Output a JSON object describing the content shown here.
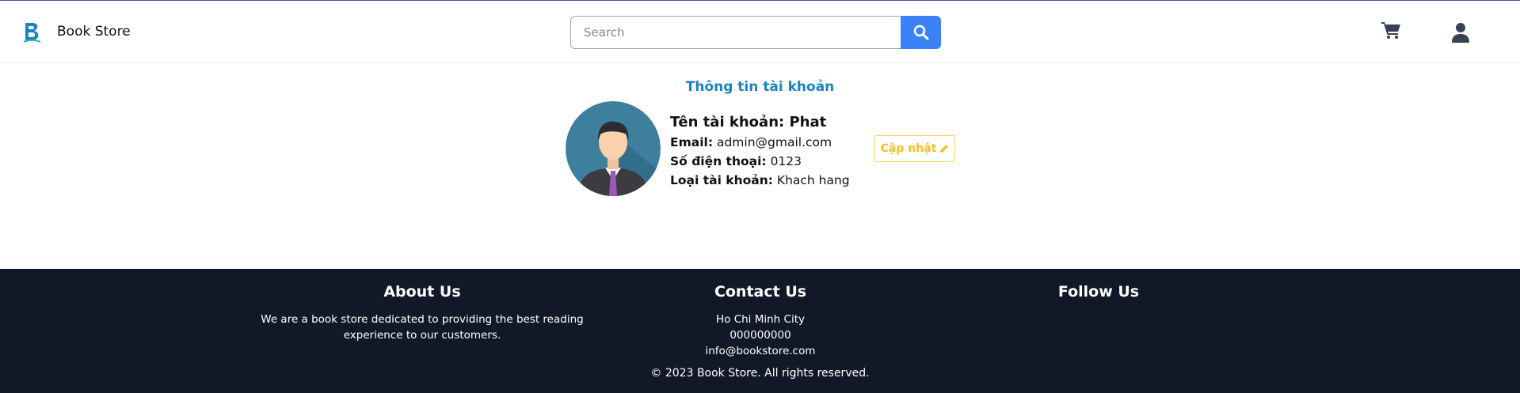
{
  "header": {
    "brand": "Book Store",
    "search": {
      "placeholder": "Search",
      "value": ""
    },
    "icons": {
      "logo": "bookstore-logo",
      "search": "search-icon",
      "cart": "cart-icon",
      "user": "user-icon"
    },
    "colors": {
      "accent": "#3b82f6",
      "logo": "#1b82c5"
    }
  },
  "account": {
    "title": "Thông tin tài khoản",
    "name_label": "Tên tài khoản:",
    "name_value": "Phat",
    "email_label": "Email:",
    "email_value": "admin@gmail.com",
    "phone_label": "Số điện thoại:",
    "phone_value": "0123",
    "type_label": "Loại tài khoản:",
    "type_value": "Khach hang",
    "update_label": "Cập nhật",
    "update_icon": "pencil-icon",
    "colors": {
      "title": "#1b82c5",
      "update": "#fbbf24"
    }
  },
  "footer": {
    "about": {
      "title": "About Us",
      "text": "We are a book store dedicated to providing the best reading experience to our customers."
    },
    "contact": {
      "title": "Contact Us",
      "city": "Ho Chi Minh City",
      "phone": "000000000",
      "email": "info@bookstore.com"
    },
    "follow": {
      "title": "Follow Us"
    },
    "copyright": "© 2023 Book Store. All rights reserved.",
    "colors": {
      "background": "#111827",
      "text": "#ffffff"
    }
  }
}
